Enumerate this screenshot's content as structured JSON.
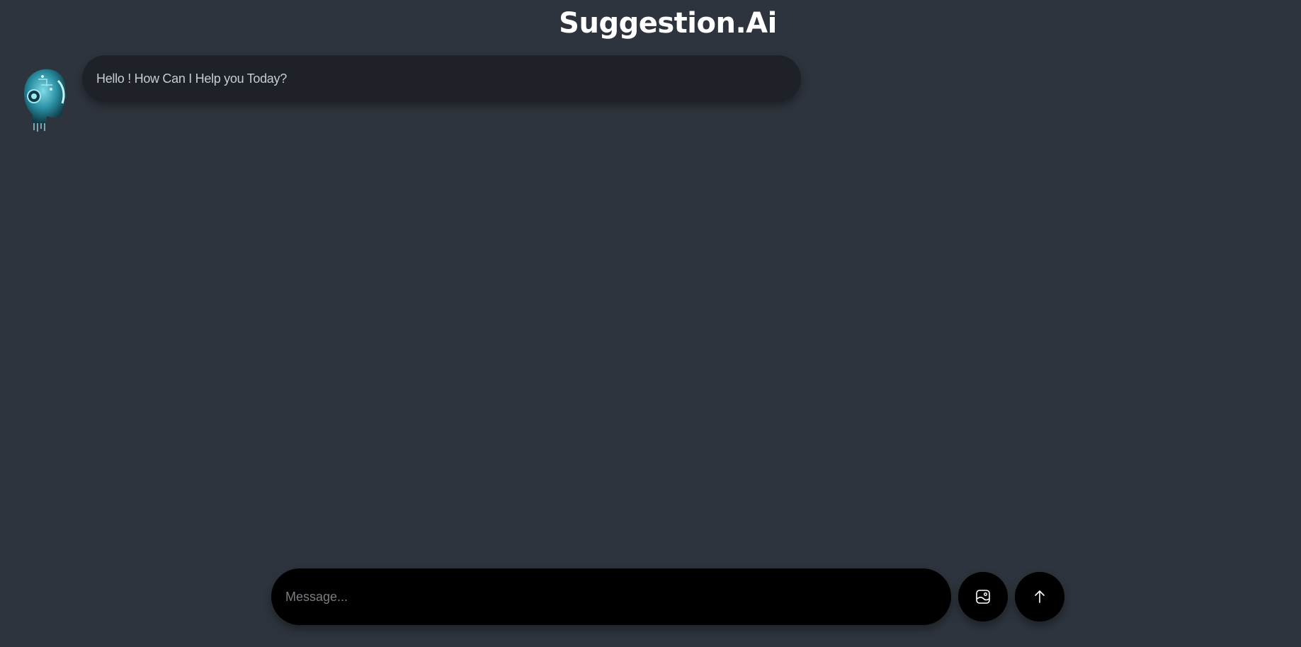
{
  "header": {
    "title": "Suggestion.Ai"
  },
  "chat": {
    "messages": [
      {
        "sender": "bot",
        "avatar_icon": "robot-head-avatar",
        "text": "Hello ! How Can I Help you Today?"
      }
    ]
  },
  "composer": {
    "placeholder": "Message...",
    "value": "",
    "image_button_icon": "image-upload-icon",
    "send_button_icon": "arrow-up-icon"
  },
  "colors": {
    "background": "#2e343d",
    "bubble": "#1e2127",
    "input": "#000000",
    "title": "#ffffff",
    "avatar_accent": "#3fb6c6"
  }
}
